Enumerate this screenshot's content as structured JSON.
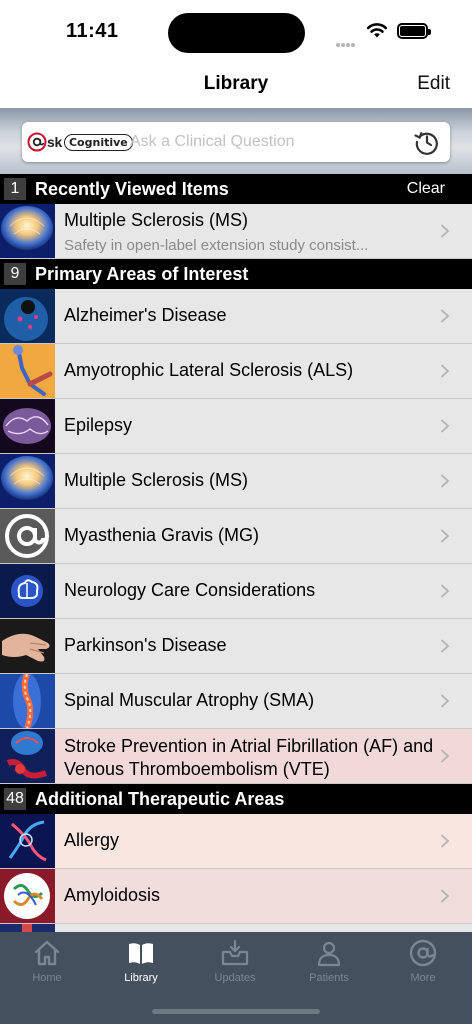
{
  "status_bar": {
    "time": "11:41"
  },
  "nav": {
    "title": "Library",
    "edit_label": "Edit"
  },
  "search": {
    "logo_text_ask": "sk",
    "logo_text_cognitive": "Cognitive",
    "placeholder": "Ask a Clinical Question"
  },
  "recent": {
    "count": "1",
    "title": "Recently Viewed Items",
    "action": "Clear",
    "items": [
      {
        "title": "Multiple Sclerosis (MS)",
        "subtitle": "Safety in open-label extension study consist..."
      }
    ]
  },
  "primary": {
    "count": "9",
    "title": "Primary Areas of Interest",
    "items": [
      {
        "title": "Alzheimer's Disease"
      },
      {
        "title": "Amyotrophic Lateral Sclerosis (ALS)"
      },
      {
        "title": "Epilepsy"
      },
      {
        "title": "Multiple Sclerosis (MS)"
      },
      {
        "title": "Myasthenia Gravis (MG)"
      },
      {
        "title": "Neurology Care Considerations"
      },
      {
        "title": "Parkinson's Disease"
      },
      {
        "title": "Spinal Muscular Atrophy (SMA)"
      },
      {
        "title": "Stroke Prevention in Atrial Fibrillation (AF) and Venous Thromboembolism (VTE)"
      }
    ]
  },
  "additional": {
    "count": "48",
    "title": "Additional Therapeutic Areas",
    "items": [
      {
        "title": "Allergy"
      },
      {
        "title": "Amyloidosis"
      }
    ]
  },
  "tabs": [
    {
      "label": "Home",
      "icon": "house-icon"
    },
    {
      "label": "Library",
      "icon": "book-icon"
    },
    {
      "label": "Updates",
      "icon": "inbox-download-icon"
    },
    {
      "label": "Patients",
      "icon": "person-icon"
    },
    {
      "label": "More",
      "icon": "at-sign-icon"
    }
  ],
  "colors": {
    "section_header": "#000000",
    "row_gray": "#e7e7e7",
    "row_pink": "#f1d9d9",
    "row_peach": "#fae6e1",
    "tab_bar": "#45505e",
    "tab_active": "#ffffff",
    "tab_inactive": "#7b8594"
  }
}
